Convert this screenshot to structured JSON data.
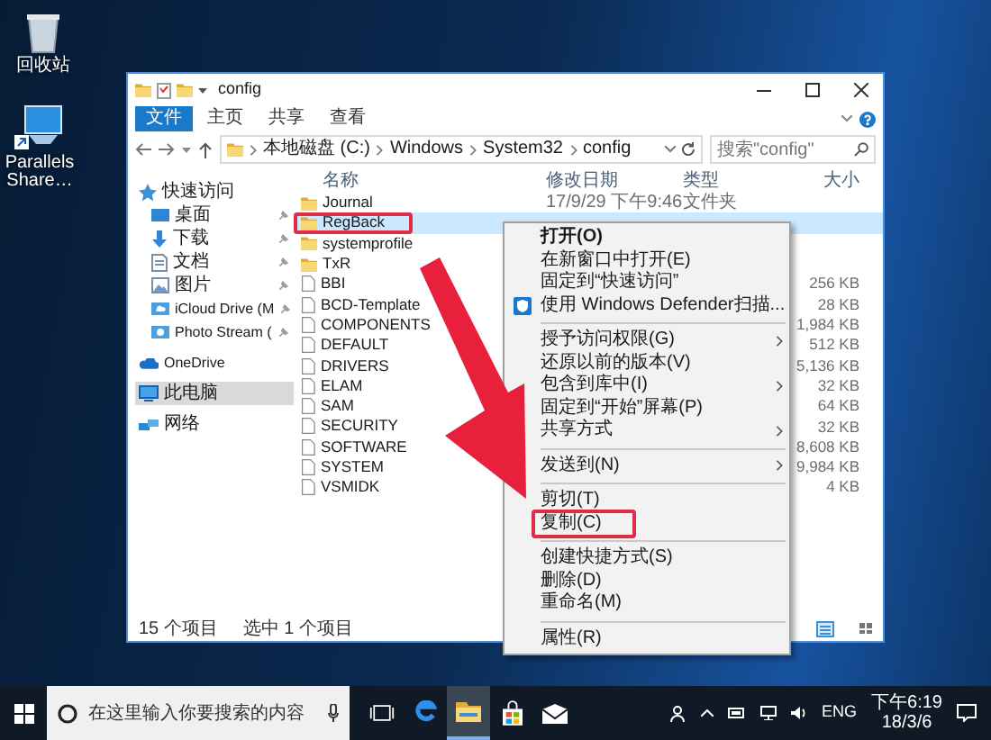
{
  "desktop_icons": [
    {
      "label": "回收站",
      "kind": "recycle"
    },
    {
      "label": "Parallels Share…",
      "kind": "shortcut"
    }
  ],
  "window": {
    "title": "config",
    "ribbon_tabs": [
      {
        "label": "文件",
        "selected": true
      },
      {
        "label": "主页",
        "selected": false
      },
      {
        "label": "共享",
        "selected": false
      },
      {
        "label": "查看",
        "selected": false
      }
    ],
    "breadcrumbs": [
      "本地磁盘 (C:)",
      "Windows",
      "System32",
      "config"
    ],
    "search": {
      "placeholder": "搜索\"config\""
    },
    "nav": [
      {
        "label": "快速访问",
        "kind": "quick",
        "selected": false,
        "children": [
          {
            "label": "桌面",
            "kind": "desktop",
            "selected": false,
            "pinned": true
          },
          {
            "label": "下载",
            "kind": "download",
            "selected": false,
            "pinned": true
          },
          {
            "label": "文档",
            "kind": "document",
            "selected": false,
            "pinned": true
          },
          {
            "label": "图片",
            "kind": "picture",
            "selected": false,
            "pinned": true
          },
          {
            "label": "iCloud Drive (M",
            "kind": "icloud",
            "selected": false,
            "pinned": true
          },
          {
            "label": "Photo Stream (",
            "kind": "photo",
            "selected": false,
            "pinned": true
          }
        ]
      },
      {
        "label": "OneDrive",
        "kind": "onedrive",
        "selected": false
      },
      {
        "label": "此电脑",
        "kind": "pc",
        "selected": true
      },
      {
        "label": "网络",
        "kind": "network",
        "selected": false
      }
    ],
    "columns": [
      "名称",
      "修改日期",
      "类型",
      "大小"
    ],
    "rows": [
      {
        "name": "Journal",
        "kind": "folder",
        "selected": false,
        "outlined": false,
        "date": "17/9/29 下午9:46",
        "type": "文件夹"
      },
      {
        "name": "RegBack",
        "kind": "folder",
        "selected": true,
        "outlined": true
      },
      {
        "name": "systemprofile",
        "kind": "folder",
        "selected": false,
        "outlined": false
      },
      {
        "name": "TxR",
        "kind": "folder",
        "selected": false,
        "outlined": false
      },
      {
        "name": "BBI",
        "kind": "file",
        "selected": false,
        "outlined": false,
        "size": "256 KB"
      },
      {
        "name": "BCD-Template",
        "kind": "file",
        "selected": false,
        "outlined": false,
        "size": "28 KB"
      },
      {
        "name": "COMPONENTS",
        "kind": "file",
        "selected": false,
        "outlined": false,
        "size": "1,984 KB"
      },
      {
        "name": "DEFAULT",
        "kind": "file",
        "selected": false,
        "outlined": false,
        "size": "512 KB"
      },
      {
        "name": "DRIVERS",
        "kind": "file",
        "selected": false,
        "outlined": false,
        "size": "5,136 KB"
      },
      {
        "name": "ELAM",
        "kind": "file",
        "selected": false,
        "outlined": false,
        "size": "32 KB"
      },
      {
        "name": "SAM",
        "kind": "file",
        "selected": false,
        "outlined": false,
        "size": "64 KB"
      },
      {
        "name": "SECURITY",
        "kind": "file",
        "selected": false,
        "outlined": false,
        "size": "32 KB"
      },
      {
        "name": "SOFTWARE",
        "kind": "file",
        "selected": false,
        "outlined": false,
        "size": "8,608 KB"
      },
      {
        "name": "SYSTEM",
        "kind": "file",
        "selected": false,
        "outlined": false,
        "size": "9,984 KB"
      },
      {
        "name": "VSMIDK",
        "kind": "file",
        "selected": false,
        "outlined": false,
        "size": "4 KB"
      }
    ],
    "status": {
      "count": "15 个项目",
      "selection": "选中 1 个项目"
    },
    "context_menu": [
      {
        "kind": "command",
        "label": "打开(O)",
        "bold": true,
        "submenu": false,
        "outlined": false
      },
      {
        "kind": "command",
        "label": "在新窗口中打开(E)",
        "bold": false,
        "submenu": false,
        "outlined": false
      },
      {
        "kind": "command",
        "label": "固定到“快速访问”",
        "bold": false,
        "submenu": false,
        "outlined": false
      },
      {
        "kind": "scan",
        "label": "使用 Windows Defender扫描...",
        "bold": false,
        "submenu": false,
        "outlined": false
      },
      {
        "kind": "separator"
      },
      {
        "kind": "command",
        "label": "授予访问权限(G)",
        "bold": false,
        "submenu": true,
        "outlined": false
      },
      {
        "kind": "command",
        "label": "还原以前的版本(V)",
        "bold": false,
        "submenu": false,
        "outlined": false
      },
      {
        "kind": "command",
        "label": "包含到库中(I)",
        "bold": false,
        "submenu": true,
        "outlined": false
      },
      {
        "kind": "command",
        "label": "固定到“开始”屏幕(P)",
        "bold": false,
        "submenu": false,
        "outlined": false
      },
      {
        "kind": "command",
        "label": "共享方式",
        "bold": false,
        "submenu": true,
        "outlined": false
      },
      {
        "kind": "separator"
      },
      {
        "kind": "command",
        "label": "发送到(N)",
        "bold": false,
        "submenu": true,
        "outlined": false
      },
      {
        "kind": "separator"
      },
      {
        "kind": "command",
        "label": "剪切(T)",
        "bold": false,
        "submenu": false,
        "outlined": false
      },
      {
        "kind": "command",
        "label": "复制(C)",
        "bold": false,
        "submenu": false,
        "outlined": true
      },
      {
        "kind": "separator"
      },
      {
        "kind": "command",
        "label": "创建快捷方式(S)",
        "bold": false,
        "submenu": false,
        "outlined": false
      },
      {
        "kind": "command",
        "label": "删除(D)",
        "bold": false,
        "submenu": false,
        "outlined": false
      },
      {
        "kind": "command",
        "label": "重命名(M)",
        "bold": false,
        "submenu": false,
        "outlined": false
      },
      {
        "kind": "separator"
      },
      {
        "kind": "command",
        "label": "属性(R)",
        "bold": false,
        "submenu": false,
        "outlined": false
      }
    ]
  },
  "annotation_arrow": true,
  "taskbar": {
    "search_placeholder": "在这里输入你要搜索的内容",
    "apps": [
      {
        "kind": "taskview",
        "active": false
      },
      {
        "kind": "edge",
        "active": false
      },
      {
        "kind": "explorer",
        "active": true
      },
      {
        "kind": "store",
        "active": false
      },
      {
        "kind": "mail",
        "active": false
      }
    ],
    "language": "ENG",
    "time": "下午6:19",
    "date": "18/3/6"
  }
}
